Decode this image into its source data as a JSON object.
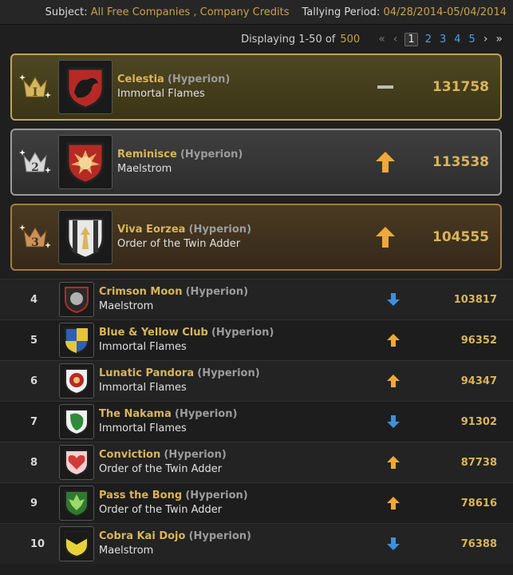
{
  "header": {
    "subject_label": "Subject:",
    "subject_value": "All Free Companies , Company Credits",
    "period_label": "Tallying Period:",
    "period_value": "04/28/2014-05/04/2014"
  },
  "pager": {
    "display_text": "Displaying 1-50 of",
    "total": "500",
    "first": "«",
    "prev": "‹",
    "pages": [
      "1",
      "2",
      "3",
      "4",
      "5"
    ],
    "current_page": "1",
    "next": "›",
    "last": "»"
  },
  "top3": [
    {
      "rank_numeral": "I",
      "name": "Celestia",
      "server": "(Hyperion)",
      "company": "Immortal Flames",
      "trend": "same",
      "score": "131758"
    },
    {
      "rank_numeral": "2",
      "name": "Reminisce",
      "server": "(Hyperion)",
      "company": "Maelstrom",
      "trend": "up",
      "score": "113538"
    },
    {
      "rank_numeral": "3",
      "name": "Viva Eorzea",
      "server": "(Hyperion)",
      "company": "Order of the Twin Adder",
      "trend": "up",
      "score": "104555"
    }
  ],
  "rows": [
    {
      "rank": "4",
      "name": "Crimson Moon",
      "server": "(Hyperion)",
      "company": "Maelstrom",
      "trend": "down",
      "score": "103817"
    },
    {
      "rank": "5",
      "name": "Blue & Yellow Club",
      "server": "(Hyperion)",
      "company": "Immortal Flames",
      "trend": "up",
      "score": "96352"
    },
    {
      "rank": "6",
      "name": "Lunatic Pandora",
      "server": "(Hyperion)",
      "company": "Immortal Flames",
      "trend": "up",
      "score": "94347"
    },
    {
      "rank": "7",
      "name": "The Nakama",
      "server": "(Hyperion)",
      "company": "Immortal Flames",
      "trend": "down",
      "score": "91302"
    },
    {
      "rank": "8",
      "name": "Conviction",
      "server": "(Hyperion)",
      "company": "Order of the Twin Adder",
      "trend": "up",
      "score": "87738"
    },
    {
      "rank": "9",
      "name": "Pass the Bong",
      "server": "(Hyperion)",
      "company": "Order of the Twin Adder",
      "trend": "up",
      "score": "78616"
    },
    {
      "rank": "10",
      "name": "Cobra Kai Dojo",
      "server": "(Hyperion)",
      "company": "Maelstrom",
      "trend": "down",
      "score": "76388"
    }
  ],
  "colors": {
    "gold": "#d9b55a",
    "up": "#f0a83a",
    "down": "#3f8fd8",
    "link": "#4aa0e6"
  }
}
